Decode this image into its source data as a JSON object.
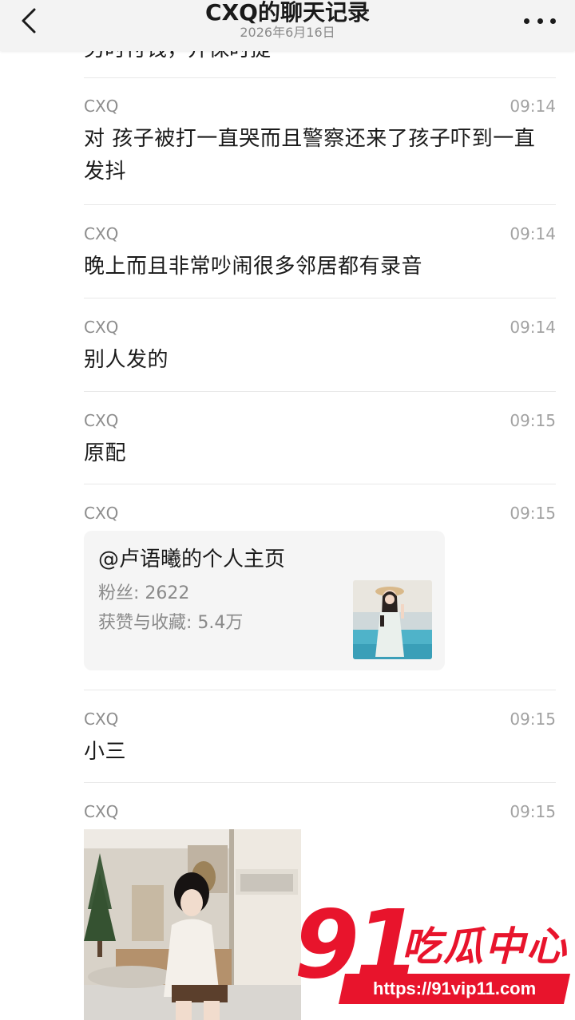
{
  "header": {
    "title": "CXQ的聊天记录",
    "subtitle": "2026年6月16日"
  },
  "partial_text": "另时付钱，并保时提",
  "messages": [
    {
      "sender": "CXQ",
      "time": "09:14",
      "text": "对 孩子被打一直哭而且警察还来了孩子吓到一直发抖"
    },
    {
      "sender": "CXQ",
      "time": "09:14",
      "text": "晚上而且非常吵闹很多邻居都有录音"
    },
    {
      "sender": "CXQ",
      "time": "09:14",
      "text": "别人发的"
    },
    {
      "sender": "CXQ",
      "time": "09:15",
      "text": "原配"
    },
    {
      "sender": "CXQ",
      "time": "09:15",
      "text": ""
    },
    {
      "sender": "CXQ",
      "time": "09:15",
      "text": "小三"
    },
    {
      "sender": "CXQ",
      "time": "09:15",
      "text": ""
    }
  ],
  "profile_card": {
    "title": "@卢语曦的个人主页",
    "fans": "粉丝: 2622",
    "likes": "获赞与收藏: 5.4万"
  },
  "watermark": {
    "number": "91",
    "chinese": "吃瓜中心",
    "url": "https://91vip11.com"
  },
  "colors": {
    "header_bg": "#f3f3f3",
    "card_bg": "#f5f5f5",
    "watermark_red": "#e8142c"
  }
}
